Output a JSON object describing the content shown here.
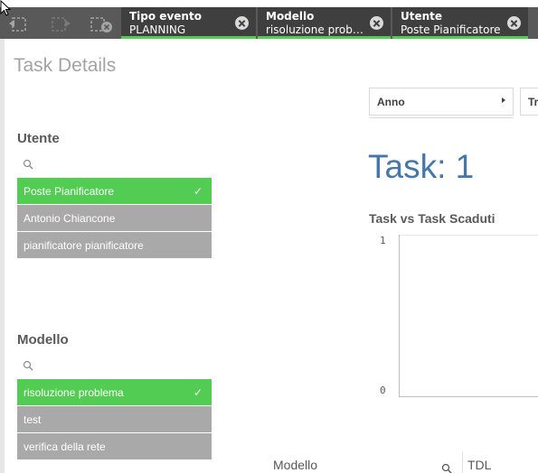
{
  "toolbar": {
    "back_icon": "selection-back-icon",
    "forward_icon": "selection-forward-icon",
    "clear_icon": "clear-selections-icon"
  },
  "selections": [
    {
      "field": "Tipo evento",
      "value": "PLANNING"
    },
    {
      "field": "Modello",
      "value": "risoluzione probl..."
    },
    {
      "field": "Utente",
      "value": "Poste Pianificatore"
    }
  ],
  "page": {
    "title": "Task Details"
  },
  "utente_pane": {
    "title": "Utente",
    "items": [
      {
        "label": "Poste Pianificatore",
        "selected": true
      },
      {
        "label": "Antonio Chiancone",
        "selected": false
      },
      {
        "label": "pianificatore pianificatore",
        "selected": false
      }
    ]
  },
  "modello_pane": {
    "title": "Modello",
    "items": [
      {
        "label": "risoluzione problema",
        "selected": true
      },
      {
        "label": "test",
        "selected": false
      },
      {
        "label": "verifica della rete",
        "selected": false
      }
    ]
  },
  "filters": {
    "anno": "Anno",
    "next": "Tr"
  },
  "kpi": {
    "label": "Task: 1"
  },
  "chart": {
    "title": "Task vs Task Scaduti",
    "y_tick_top": "1",
    "y_tick_bottom": "0"
  },
  "chart_data": {
    "type": "bar",
    "title": "Task vs Task Scaduti",
    "ylim": [
      0,
      1
    ],
    "y_ticks": [
      "0",
      "1"
    ],
    "categories": [],
    "values": [],
    "grid": true
  },
  "table": {
    "col_modello": "Modello",
    "col_tdl": "TDL"
  },
  "colors": {
    "selected": "#52cc52",
    "alternative": "#a9a9a9",
    "kpi": "#4477aa",
    "selection_bar": "#595959"
  }
}
